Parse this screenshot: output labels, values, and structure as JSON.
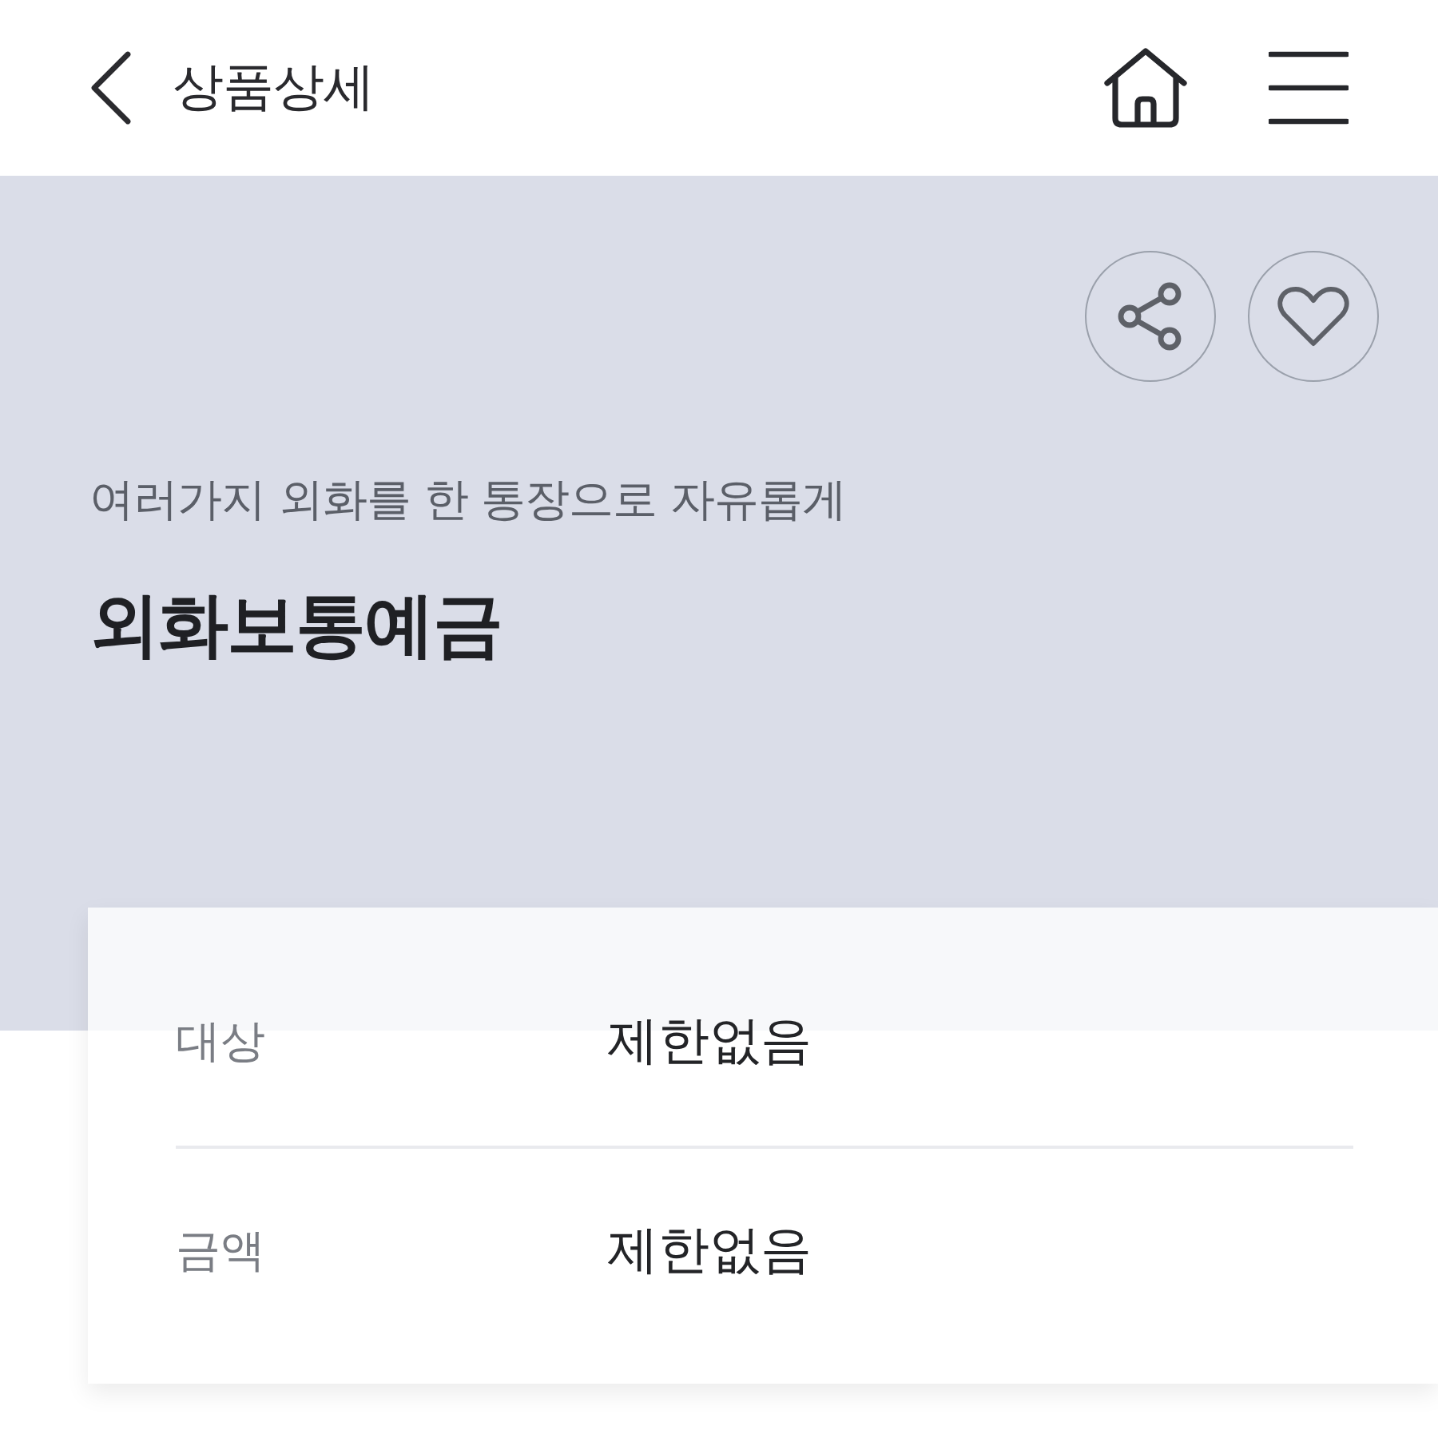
{
  "header": {
    "title": "상품상세"
  },
  "hero": {
    "subtitle": "여러가지 외화를 한 통장으로 자유롭게",
    "title": "외화보통예금",
    "liked": false
  },
  "details": [
    {
      "label": "대상",
      "value": "제한없음"
    },
    {
      "label": "금액",
      "value": "제한없음"
    }
  ]
}
